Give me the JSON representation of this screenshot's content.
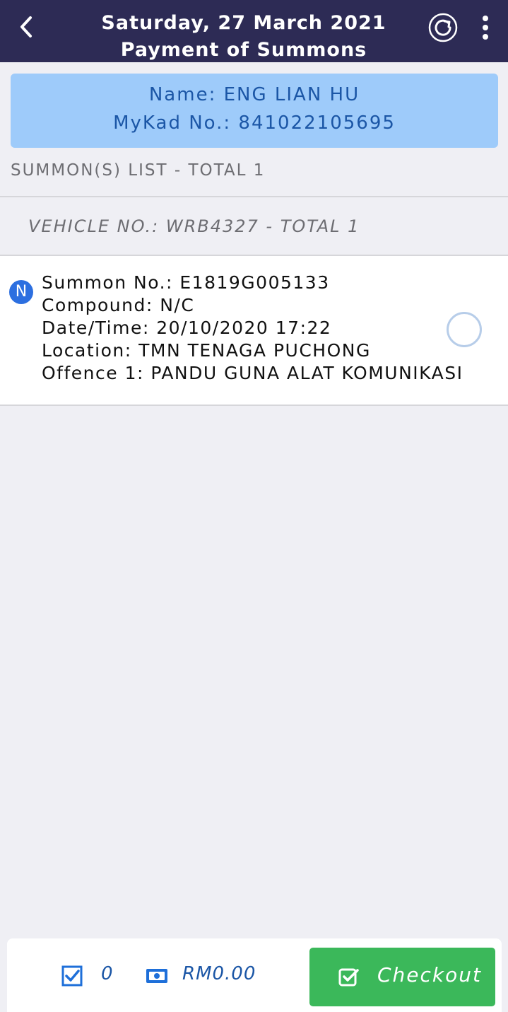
{
  "header": {
    "date": "Saturday, 27 March 2021",
    "title": "Payment of Summons",
    "back_icon": "chevron-left-icon",
    "refresh_icon": "refresh-icon",
    "more_icon": "more-vertical-icon",
    "background_color": "#2d2b55"
  },
  "profile": {
    "name_line": "Name: ENG LIAN HU",
    "mykad_line": "MyKad No.: 841022105695",
    "background_color": "#9ecbfa",
    "text_color": "#1b56a6"
  },
  "summons_list": {
    "title": "SUMMON(S) LIST - TOTAL 1",
    "vehicle_group": {
      "title": "VEHICLE NO.: WRB4327 - TOTAL 1",
      "items": [
        {
          "badge": "N",
          "summon_no": "Summon No.: E1819G005133",
          "compound": "Compound: N/C",
          "datetime": "Date/Time: 20/10/2020 17:22",
          "location": "Location: TMN TENAGA PUCHONG",
          "offence": "Offence 1: PANDU GUNA ALAT KOMUNIKASI",
          "selected": false
        }
      ]
    }
  },
  "footer": {
    "selected_count": "0",
    "total_amount": "RM0.00",
    "checkout_label": "Checkout",
    "checkout_color": "#3bb85a",
    "checked_icon": "checkbox-checked-icon",
    "money_icon": "banknote-icon",
    "checkout_icon": "check-square-icon"
  }
}
